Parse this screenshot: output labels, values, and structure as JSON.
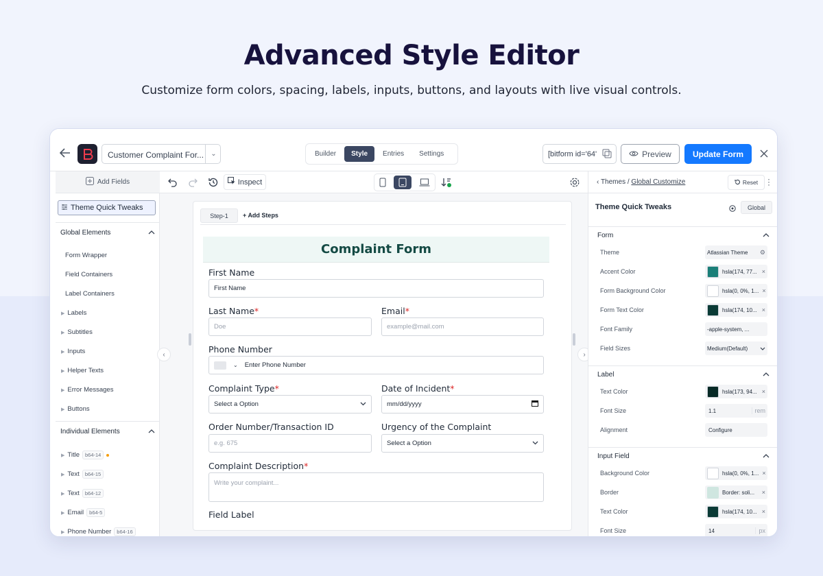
{
  "hero": {
    "title": "Advanced Style Editor",
    "subtitle": "Customize form colors, spacing, labels, inputs, buttons, and layouts with live visual controls."
  },
  "header": {
    "form_name": "Customer Complaint For...",
    "tabs": [
      "Builder",
      "Style",
      "Entries",
      "Settings"
    ],
    "active_tab": "Style",
    "shortcode": "[bitform id='64'",
    "preview_label": "Preview",
    "update_label": "Update Form",
    "brand_color": "#1479ff"
  },
  "left_sidebar": {
    "add_fields": "Add Fields",
    "theme_quick_tweaks": "Theme Quick Tweaks",
    "global_elements_title": "Global Elements",
    "global_items": [
      "Form Wrapper",
      "Field Containers",
      "Label Containers",
      "Labels",
      "Subtitles",
      "Inputs",
      "Helper Texts",
      "Error Messages",
      "Buttons"
    ],
    "individual_elements_title": "Individual Elements",
    "individual_items": [
      {
        "label": "Title",
        "badge": "b64-14"
      },
      {
        "label": "Text",
        "badge": "b64-15"
      },
      {
        "label": "Text",
        "badge": "b64-12"
      },
      {
        "label": "Email",
        "badge": "b64-5"
      },
      {
        "label": "Phone Number",
        "badge": "b64-16"
      }
    ]
  },
  "canvas": {
    "inspect_label": "Inspect",
    "step_label": "Step-1",
    "add_steps": "Add Steps",
    "form_title": "Complaint Form",
    "fields": {
      "first_name_label": "First Name",
      "first_name_value": "First Name",
      "last_name_label": "Last Name",
      "last_name_placeholder": "Doe",
      "email_label": "Email",
      "email_placeholder": "example@mail.com",
      "phone_label": "Phone Number",
      "phone_placeholder": "Enter Phone Number",
      "complaint_type_label": "Complaint Type",
      "complaint_type_value": "Select a Option",
      "incident_date_label": "Date of Incident",
      "incident_date_value": "mm/dd/yyyy",
      "order_label": "Order Number/Transaction ID",
      "order_placeholder": "e.g. 675",
      "urgency_label": "Urgency of the Complaint",
      "urgency_value": "Select a Option",
      "description_label": "Complaint Description",
      "description_placeholder": "Write your complaint...",
      "field_label": "Field Label",
      "required_mark": "*"
    },
    "heading_color": "#144a44",
    "heading_bg": "#eef7f5"
  },
  "right_sidebar": {
    "breadcrumb_prefix": "Themes /",
    "breadcrumb_link": "Global Customize",
    "reset_label": "Reset",
    "title": "Theme Quick Tweaks",
    "global_label": "Global",
    "form_section": {
      "title": "Form",
      "rows": [
        {
          "label": "Theme",
          "value": "Atlassian Theme"
        },
        {
          "label": "Accent Color",
          "value": "hsla(174, 77...",
          "swatch": "#1a7f78"
        },
        {
          "label": "Form Background Color",
          "value": "hsla(0, 0%, 1...",
          "swatch": "#ffffff"
        },
        {
          "label": "Form Text Color",
          "value": "hsla(174, 10...",
          "swatch": "#0b3b36"
        },
        {
          "label": "Font Family",
          "value": "-apple-system, ..."
        },
        {
          "label": "Field Sizes",
          "value": "Medium(Default)"
        }
      ]
    },
    "label_section": {
      "title": "Label",
      "rows": [
        {
          "label": "Text Color",
          "value": "hsla(173, 94...",
          "swatch": "#072a26"
        },
        {
          "label": "Font Size",
          "value": "1.1",
          "unit": "rem"
        },
        {
          "label": "Alignment",
          "value": "Configure"
        }
      ]
    },
    "input_section": {
      "title": "Input Field",
      "rows": [
        {
          "label": "Background Color",
          "value": "hsla(0, 0%, 1...",
          "swatch": "#ffffff"
        },
        {
          "label": "Border",
          "value": "Border: soli...",
          "swatch": "#cfe6e0"
        },
        {
          "label": "Text Color",
          "value": "hsla(174, 10...",
          "swatch": "#0b3b36"
        },
        {
          "label": "Font Size",
          "value": "14",
          "unit": "px"
        }
      ]
    }
  }
}
